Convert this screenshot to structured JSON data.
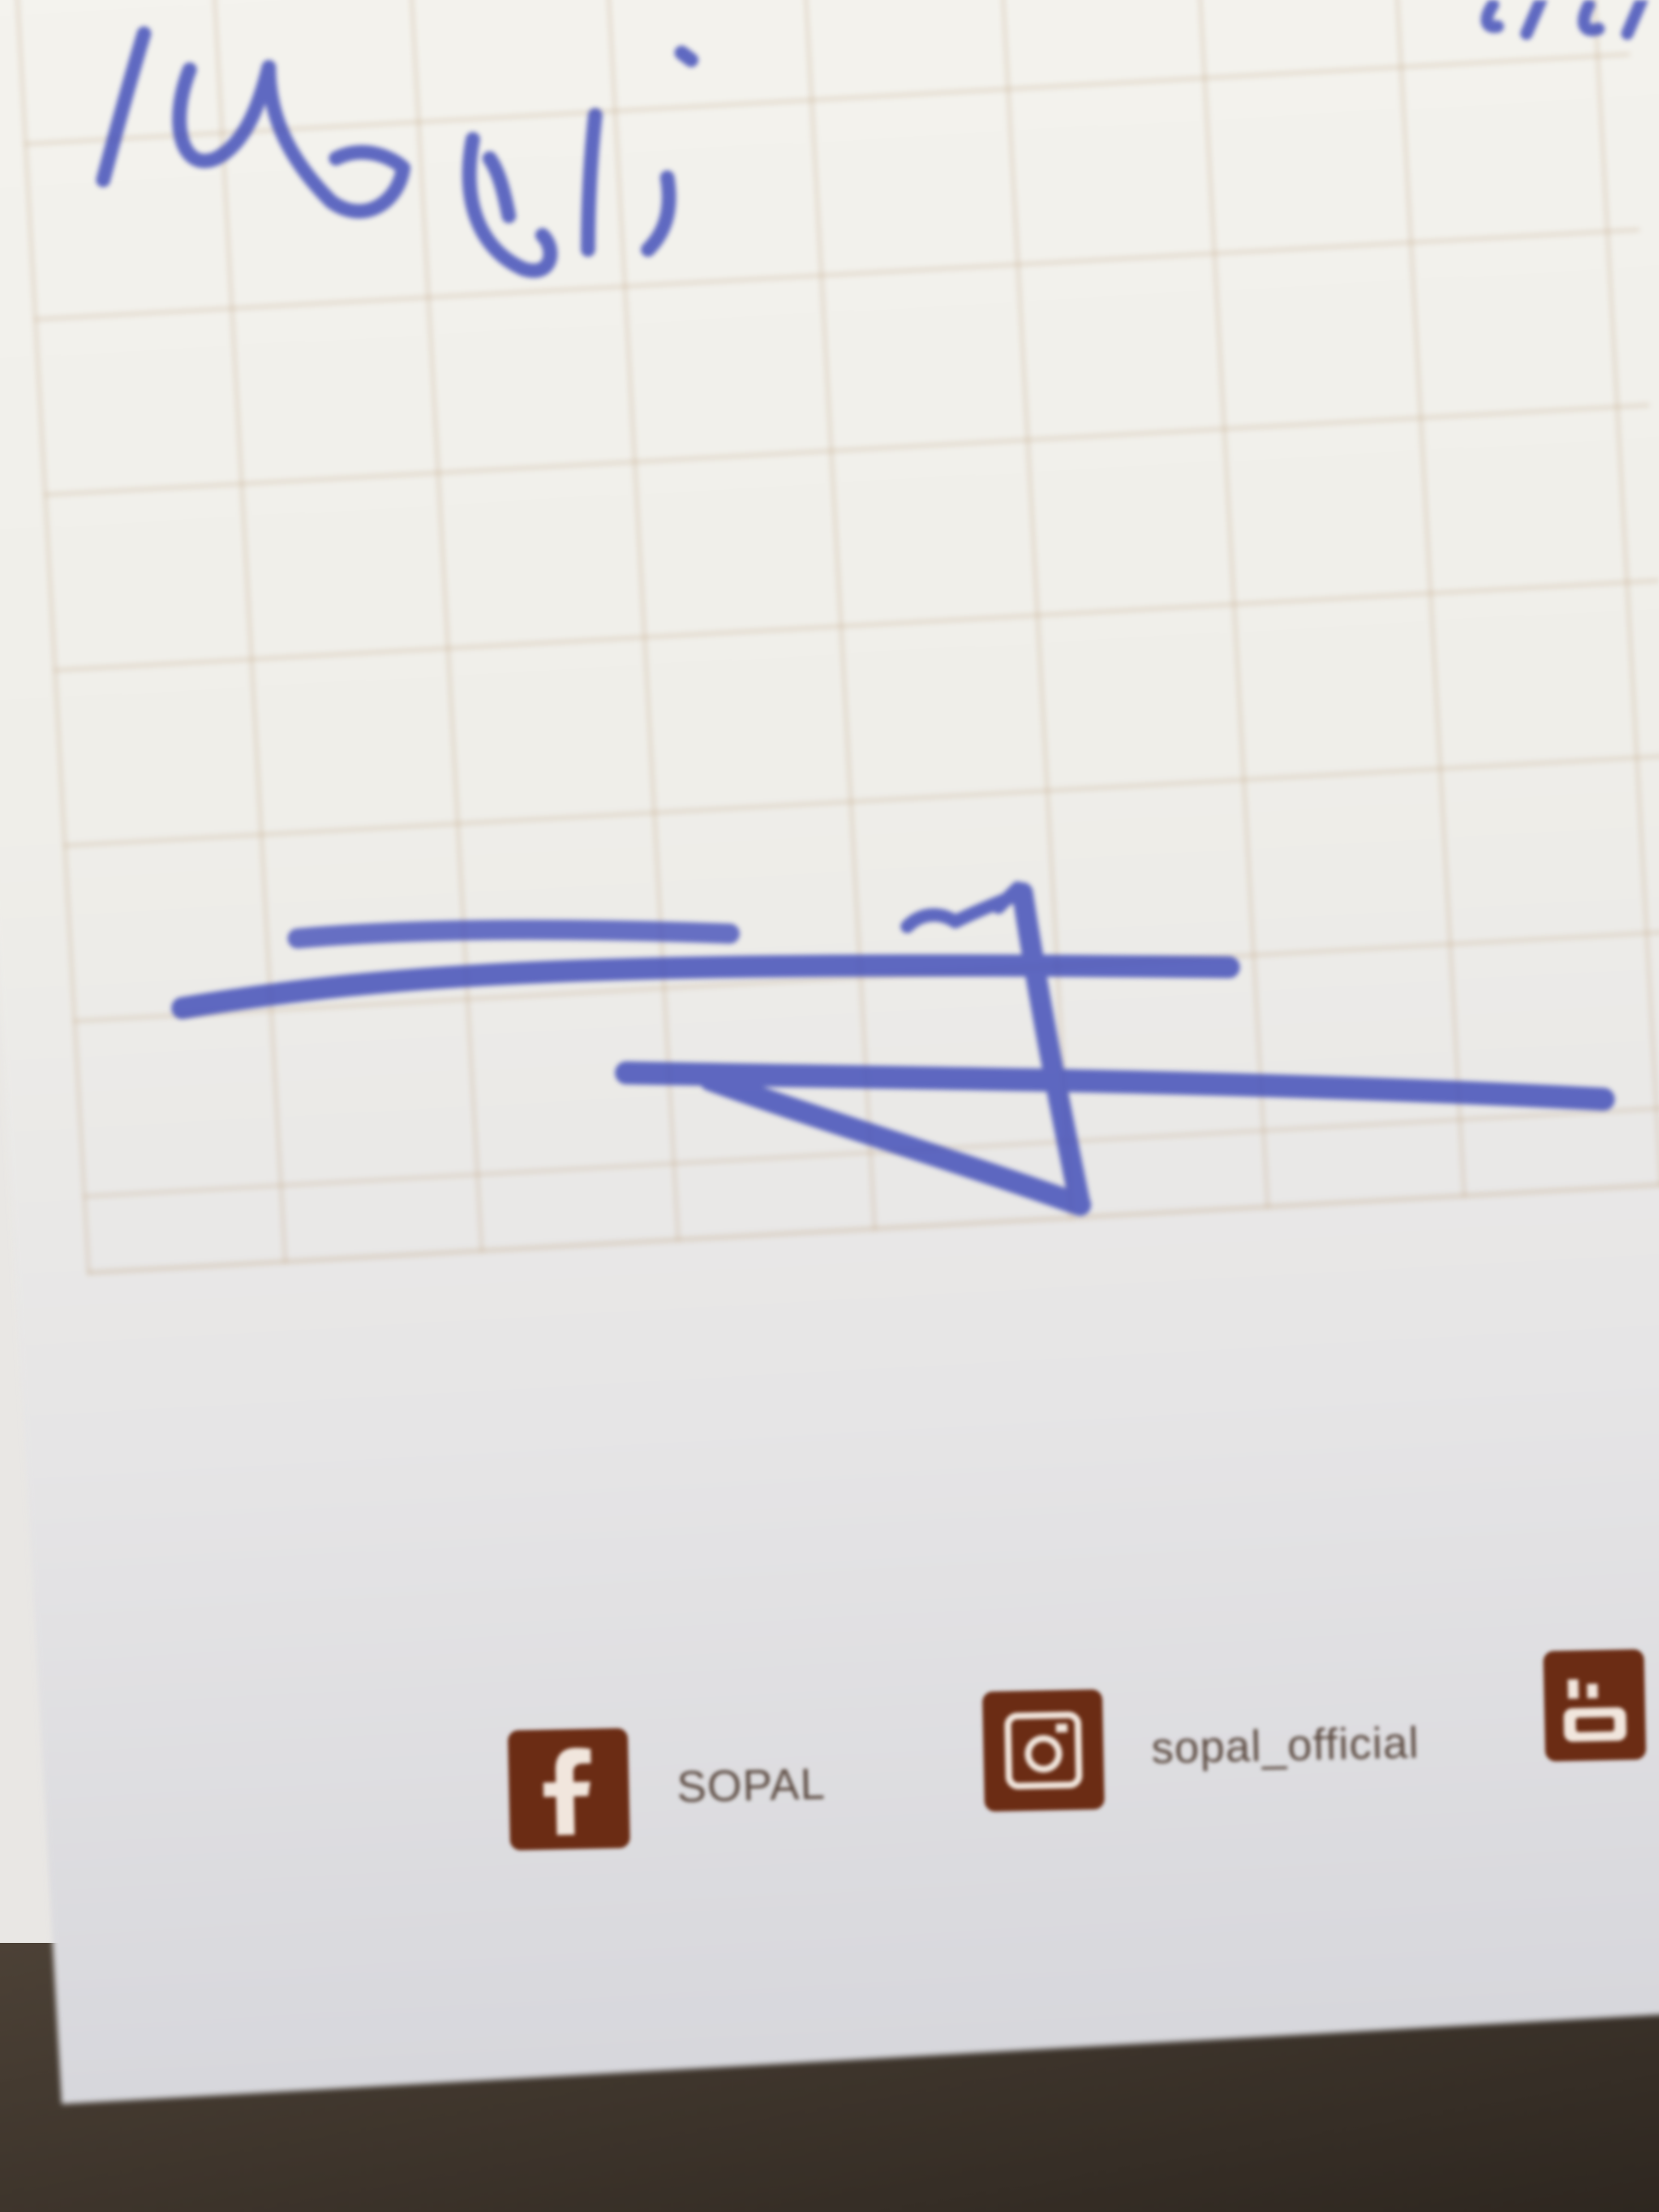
{
  "handwriting": {
    "word_lines": "lundì;",
    "corner_fragment": "6, 6/",
    "signature_note": "ving"
  },
  "footer": {
    "facebook_label": "SOPAL",
    "instagram_label": "sopal_official"
  },
  "icons": [
    "facebook-icon",
    "instagram-icon",
    "youtube-icon"
  ],
  "colors": {
    "paper": "#f4f3ee",
    "grid": "#c4aa8c",
    "ink": "#3f4bb8",
    "brand": "#6b2c14"
  }
}
